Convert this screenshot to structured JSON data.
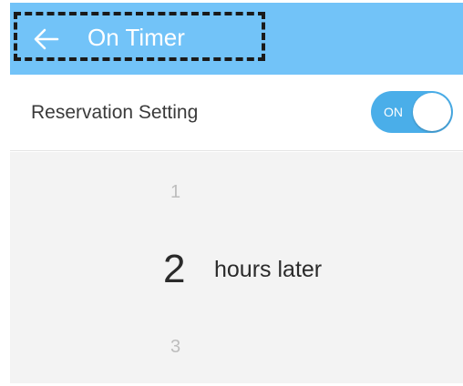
{
  "header": {
    "title": "On Timer",
    "back_icon": "arrow-left-icon",
    "background_color": "#72c3f8"
  },
  "reservation": {
    "label": "Reservation Setting",
    "toggle_text": "ON",
    "toggle_state": true,
    "toggle_color": "#4aaee9"
  },
  "picker": {
    "previous_value": "1",
    "selected_value": "2",
    "unit_label": "hours later",
    "next_value": "3"
  }
}
